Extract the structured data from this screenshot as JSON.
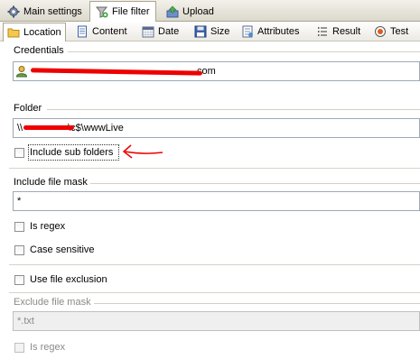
{
  "tabs": {
    "top": [
      {
        "label": "Main settings",
        "icon": "gear-icon"
      },
      {
        "label": "File filter",
        "icon": "file-filter-icon"
      },
      {
        "label": "Upload",
        "icon": "upload-icon"
      }
    ],
    "sub": [
      {
        "label": "Location",
        "icon": "folder-icon"
      },
      {
        "label": "Content",
        "icon": "document-icon"
      },
      {
        "label": "Date",
        "icon": "calendar-icon"
      },
      {
        "label": "Size",
        "icon": "disk-icon"
      },
      {
        "label": "Attributes",
        "icon": "attributes-icon"
      },
      {
        "label": "Result",
        "icon": "list-icon"
      },
      {
        "label": "Test",
        "icon": "test-icon"
      }
    ]
  },
  "credentials": {
    "label": "Credentials",
    "value_suffix": ".com",
    "icon": "user-icon"
  },
  "folder": {
    "label": "Folder",
    "value_prefix": "\\\\",
    "value_suffix": "\\c$\\wwwLive",
    "include_sub_folders": "Include sub folders"
  },
  "include_mask": {
    "label": "Include file mask",
    "value": "*",
    "is_regex": "Is regex",
    "case_sensitive": "Case sensitive"
  },
  "exclusion": {
    "use_label": "Use file exclusion",
    "exclude_label": "Exclude file mask",
    "exclude_value": "*.txt",
    "is_regex": "Is regex"
  },
  "colors": {
    "annotation": "#ee0000",
    "tab_border": "#a9a493"
  }
}
